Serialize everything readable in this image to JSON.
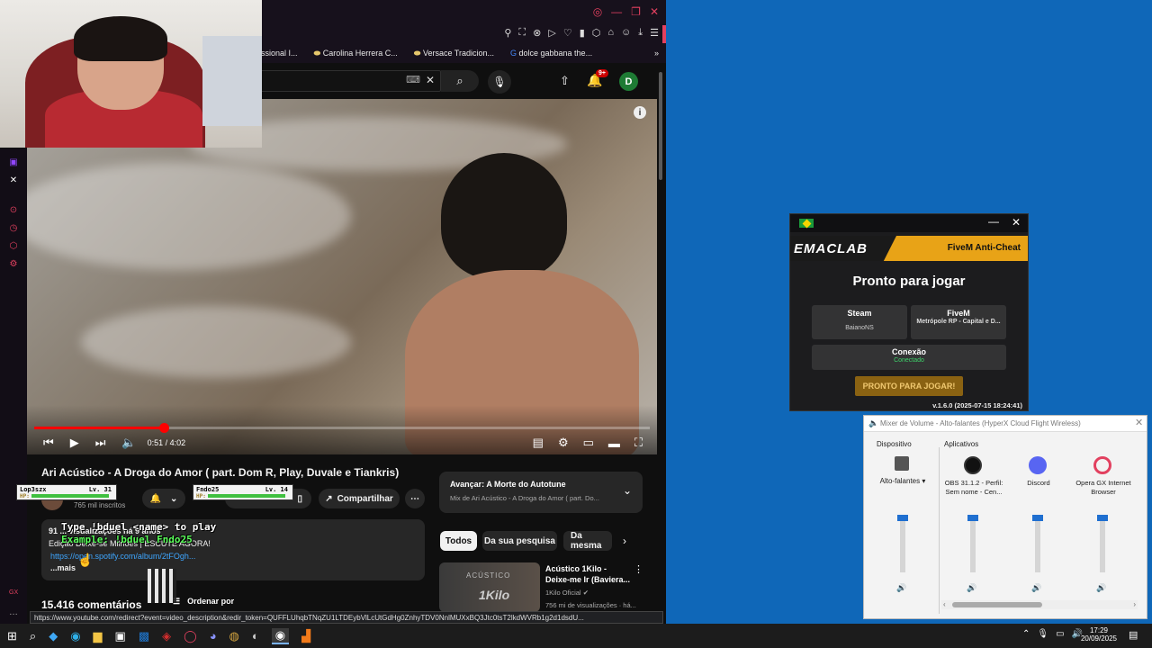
{
  "browser": {
    "bookmarks": [
      "ssional I...",
      "Carolina Herrera C...",
      "Versace Tradicion...",
      "dolce gabbana the..."
    ],
    "avatar_letter": "D",
    "notification_count": "9+"
  },
  "video": {
    "time": "0:51 / 4:02",
    "progress": 0.21,
    "title": "Ari Acústico - A Droga do Amor ( part. Dom R, Play, Duvale e Tiankris)",
    "subscribers": "765 mil inscritos",
    "share_label": "Compartilhar",
    "desc_line1": "91 ... visualizações há 9 anos",
    "desc_line2": "Edição Deixe-se Milhões | ESCUTE AGORA!",
    "desc_link": "https://open.spotify.com/album/2tFOgh...",
    "more": "...mais",
    "comments_count": "15.416 comentários",
    "sort_label": "Ordenar por"
  },
  "overlay": {
    "player1_name": "Lop3szx",
    "player1_lv": "Lv. 31",
    "player2_name": "Fndo25",
    "player2_lv": "Lv. 14",
    "cmd_line1": "Type !bduel <name> to play",
    "cmd_line2": "Example: !bduel Fndo25",
    "hp_label": "HP:"
  },
  "next_panel": {
    "title": "Avançar: A Morte do Autotune",
    "subtitle": "Mix de Ari Acústico - A Droga do Amor ( part. Do...",
    "chips": [
      "Todos",
      "Da sua pesquisa",
      "Da mesma"
    ],
    "rec_title": "Acústico 1Kilo - Deixe-me Ir (Baviera...",
    "rec_channel": "1Kilo Oficial",
    "rec_meta": "756 mi de visualizações · há...",
    "thumb_text1": "ACÚSTICO",
    "thumb_text2": "1Kilo"
  },
  "status_url": "https://www.youtube.com/redirect?event=video_description&redir_token=QUFFLUhqbTNqZU1LTDEybVlLcUtGdHg0ZnhyTDV0NnlMUXxBQ3Jtc0tsT2lkdWVRb1g2d1dsdU...",
  "emac": {
    "brand": "EMACLAB",
    "product": "FiveM Anti-Cheat",
    "heading": "Pronto para jogar",
    "steam_label": "Steam",
    "steam_value": "BaianoNS",
    "fivem_label": "FiveM",
    "fivem_value": "Metrópole RP - Capital e D...",
    "conn_label": "Conexão",
    "conn_value": "Conectado",
    "button": "PRONTO PARA JOGAR!",
    "version": "v.1.6.0 (2025-07-15 18:24:41)",
    "accent": "#e8a317"
  },
  "mixer": {
    "title": "Mixer de Volume - Alto-falantes (HyperX Cloud Flight Wireless)",
    "device_header": "Dispositivo",
    "apps_header": "Aplicativos",
    "device_name": "Alto-falantes",
    "apps": [
      {
        "name": "OBS 31.1.2 - Perfil: Sem nome - Cen..."
      },
      {
        "name": "Discord"
      },
      {
        "name": "Opera GX Internet Browser"
      }
    ]
  },
  "taskbar": {
    "time": "17:29",
    "date": "20/09/2025"
  }
}
